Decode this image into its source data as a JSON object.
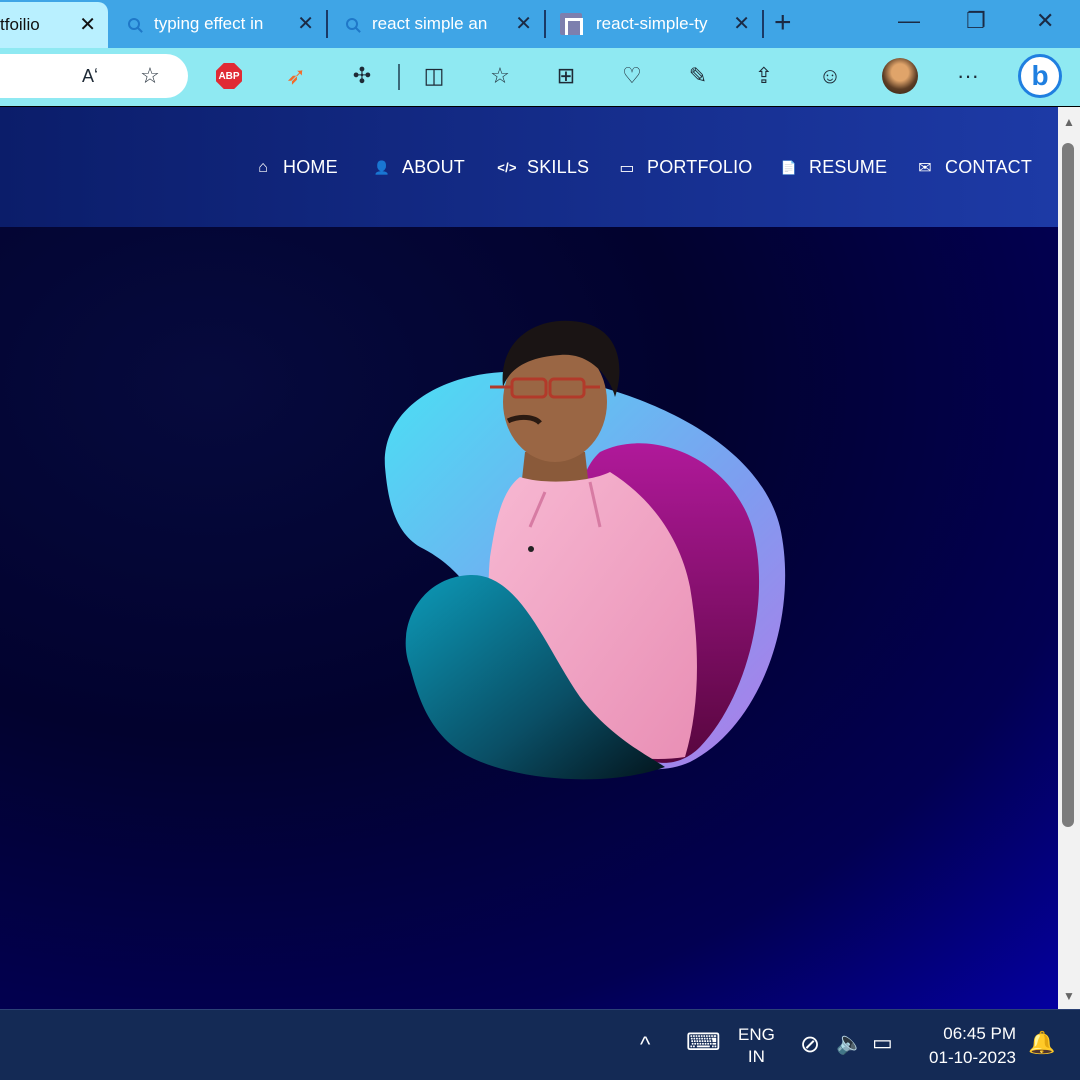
{
  "browser": {
    "tabs": [
      {
        "label": "tfoilio",
        "active": true,
        "icon": "none"
      },
      {
        "label": "typing effect in",
        "active": false,
        "icon": "search-icon"
      },
      {
        "label": "react simple an",
        "active": false,
        "icon": "search-icon"
      },
      {
        "label": "react-simple-ty",
        "active": false,
        "icon": "site-icon"
      }
    ],
    "tab_close_glyph": "✕",
    "new_tab_glyph": "+",
    "window_controls": {
      "minimize": "—",
      "restore": "❐",
      "close": "✕"
    },
    "toolbar_icons": [
      "read-aloud-icon",
      "favorite-star-icon",
      "adblock-icon",
      "swift-icon",
      "extensions-icon",
      "split-screen-icon",
      "favorites-icon",
      "collections-icon",
      "browser-essentials-icon",
      "screenshot-icon",
      "share-icon",
      "feedback-icon",
      "profile-avatar",
      "more-icon",
      "bing-copilot-icon"
    ],
    "abp_label": "ABP",
    "read_aloud_glyph": "Aʻ",
    "bing_glyph": "b",
    "more_glyph": "···"
  },
  "nav": {
    "items": [
      {
        "label": "HOME",
        "icon": "home-icon",
        "glyph": "⌂"
      },
      {
        "label": "ABOUT",
        "icon": "user-icon",
        "glyph": "👤"
      },
      {
        "label": "SKILLS",
        "icon": "code-icon",
        "glyph": "</>"
      },
      {
        "label": "PORTFOLIO",
        "icon": "monitor-icon",
        "glyph": "▭"
      },
      {
        "label": "RESUME",
        "icon": "document-icon",
        "glyph": "📄"
      },
      {
        "label": "CONTACT",
        "icon": "envelope-icon",
        "glyph": "✉"
      }
    ]
  },
  "colors": {
    "navbar_left": "#0b1d6a",
    "navbar_right": "#1d3aa6",
    "blob_cyan": "#4ae0f4",
    "blob_magenta": "#a3168f",
    "blob_teal": "#0b8aa6",
    "shirt_pink": "#f4a6c6"
  },
  "taskbar": {
    "chevron": "^",
    "lang_line1": "ENG",
    "lang_line2": "IN",
    "time": "06:45 PM",
    "date": "01-10-2023",
    "tray_icons": [
      "show-hidden-icon",
      "keyboard-icon",
      "network-icon",
      "volume-icon",
      "battery-icon",
      "notifications-icon"
    ]
  }
}
